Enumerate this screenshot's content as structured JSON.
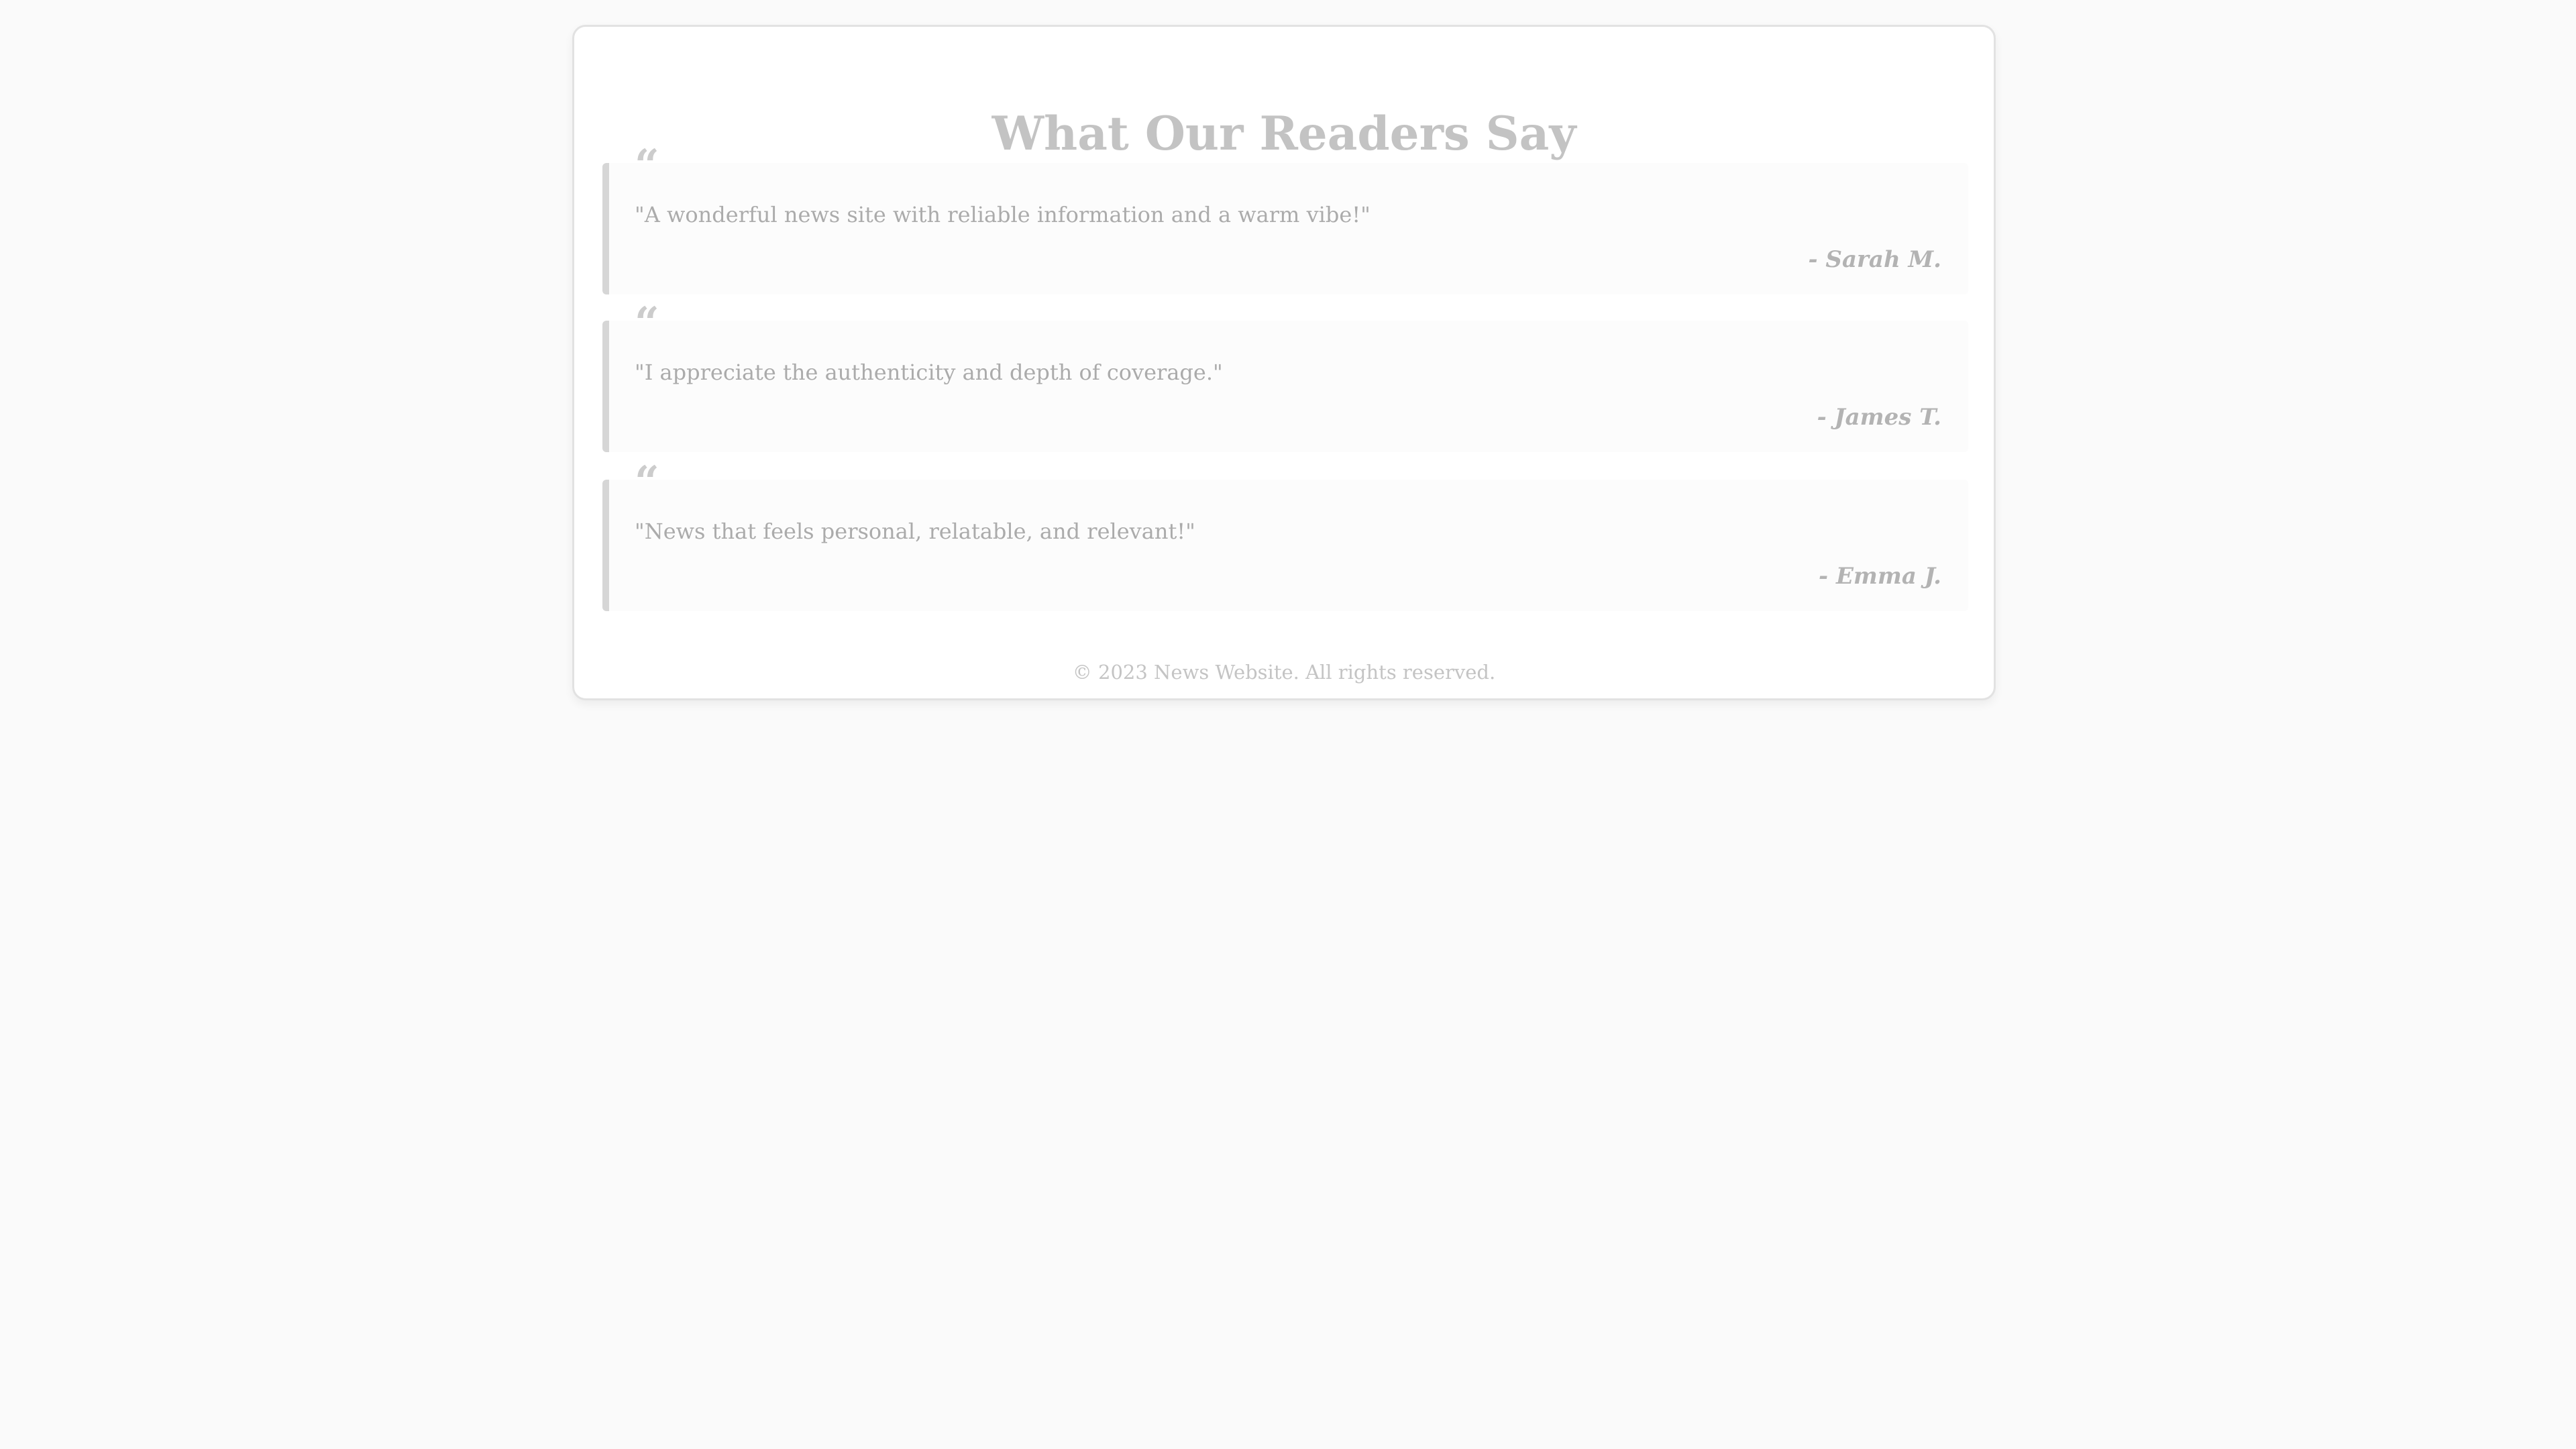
{
  "page": {
    "title": "What Our Readers Say"
  },
  "testimonials": [
    {
      "quote_mark": "“",
      "text": "\"A wonderful news site with reliable information and a warm vibe!\"",
      "author": "- Sarah M."
    },
    {
      "quote_mark": "“",
      "text": "\"I appreciate the authenticity and depth of coverage.\"",
      "author": "- James T."
    },
    {
      "quote_mark": "“",
      "text": "\"News that feels personal, relatable, and relevant!\"",
      "author": "- Emma J."
    }
  ],
  "footer": {
    "text": "© 2023 News Website. All rights reserved."
  },
  "colors": {
    "background": "#fafafa",
    "card": "#ffffff",
    "accent_border": "#d6d6d6",
    "title": "#c3c3c3",
    "text": "#ababab"
  }
}
